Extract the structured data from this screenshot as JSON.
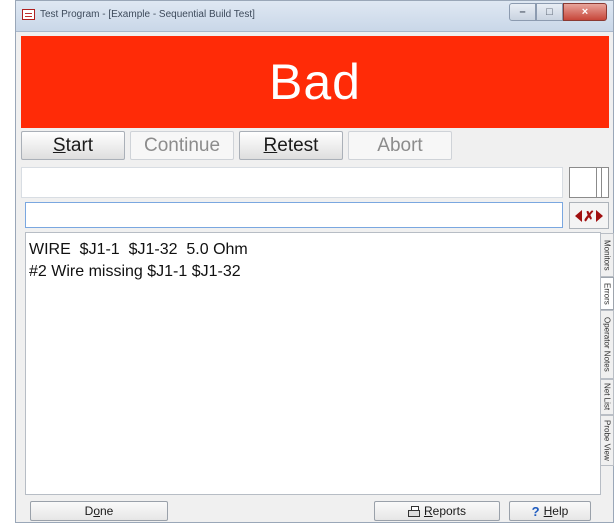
{
  "window": {
    "title": "Test Program - [Example - Sequential Build Test]"
  },
  "status": {
    "text": "Bad",
    "color": "#ff2b07"
  },
  "toolbar": {
    "start": {
      "pre": "",
      "key": "S",
      "post": "tart"
    },
    "continue": {
      "label": "Continue"
    },
    "retest": {
      "pre": "",
      "key": "R",
      "post": "etest"
    },
    "abort": {
      "label": "Abort"
    }
  },
  "input": {
    "value": ""
  },
  "output": {
    "lines": [
      "WIRE  $J1-1  $J1-32  5.0 Ohm",
      "#2 Wire missing $J1-1 $J1-32"
    ]
  },
  "side_tabs": [
    "Monitors",
    "Errors",
    "Operator Notes",
    "Net List",
    "Probe View"
  ],
  "bottom": {
    "done": {
      "pre": "D",
      "key": "o",
      "post": "ne"
    },
    "reports": {
      "pre": "",
      "key": "R",
      "post": "eports"
    },
    "help": {
      "pre": "",
      "key": "H",
      "post": "elp"
    }
  },
  "icons": {
    "app": "app-icon",
    "minimize": "minimize-icon",
    "maximize": "maximize-icon",
    "close": "close-icon",
    "nav_prev": "arrow-left-icon",
    "nav_next": "arrow-right-icon",
    "reports": "printer-icon",
    "help": "help-icon"
  }
}
